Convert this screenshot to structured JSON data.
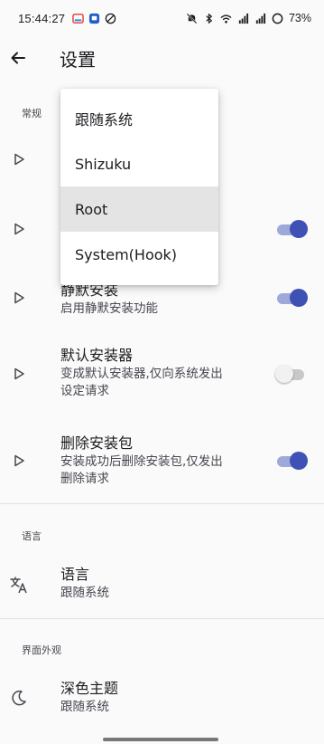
{
  "status_bar": {
    "time": "15:44:27",
    "battery": "73%",
    "left_icons": [
      "notification-app-icon",
      "notification-square-icon",
      "circle-slash-icon"
    ],
    "right_icons": [
      "mute-bell-icon",
      "bluetooth-icon",
      "wifi-icon",
      "signal-5g-icon",
      "signal-5g-icon",
      "battery-ring-icon"
    ]
  },
  "app_bar": {
    "title": "设置"
  },
  "sections": {
    "general": "常规",
    "language": "语言",
    "appearance": "界面外观"
  },
  "dropdown": {
    "options": [
      "跟随系统",
      "Shizuku",
      "Root",
      "System(Hook)"
    ],
    "selected": "Root"
  },
  "rows": {
    "silent_install": {
      "title": "静默安装",
      "subtitle": "启用静默安装功能",
      "enabled": true
    },
    "default_installer": {
      "title": "默认安装器",
      "subtitle_line1": "变成默认安装器,仅向系统发出",
      "subtitle_line2": "设定请求",
      "enabled": false
    },
    "delete_package": {
      "title": "删除安装包",
      "subtitle_line1": "安装成功后删除安装包,仅发出",
      "subtitle_line2": "删除请求",
      "enabled": true
    },
    "row2_toggle": {
      "enabled": true
    },
    "language": {
      "title": "语言",
      "subtitle": "跟随系统"
    },
    "dark_theme": {
      "title": "深色主题",
      "subtitle": "跟随系统"
    }
  },
  "colors": {
    "accent": "#3f51b5",
    "accent_track": "#9fa8da"
  }
}
